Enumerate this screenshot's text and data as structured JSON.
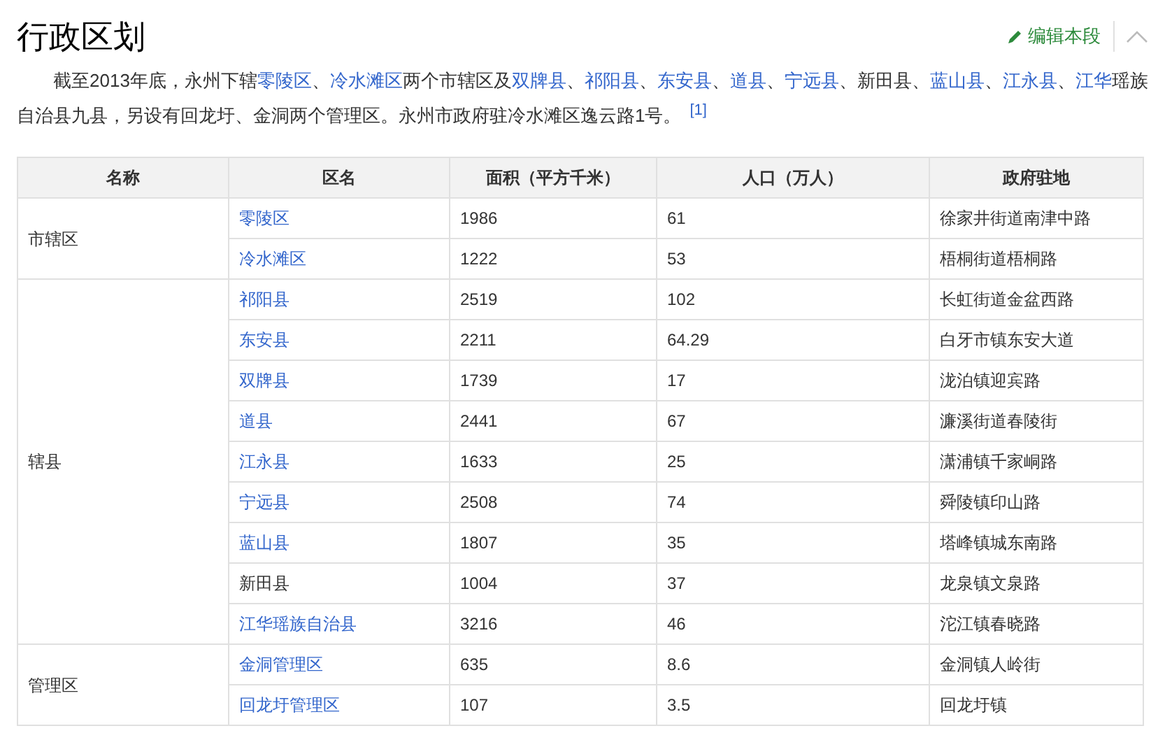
{
  "heading": "行政区划",
  "edit_link": "编辑本段",
  "paragraph": [
    {
      "text": "截至2013年底，永州下辖",
      "link": false
    },
    {
      "text": "零陵区",
      "link": true
    },
    {
      "text": "、",
      "link": false
    },
    {
      "text": "冷水滩区",
      "link": true
    },
    {
      "text": "两个市辖区及",
      "link": false
    },
    {
      "text": "双牌县",
      "link": true
    },
    {
      "text": "、",
      "link": false
    },
    {
      "text": "祁阳县",
      "link": true
    },
    {
      "text": "、",
      "link": false
    },
    {
      "text": "东安县",
      "link": true
    },
    {
      "text": "、",
      "link": false
    },
    {
      "text": "道县",
      "link": true
    },
    {
      "text": "、",
      "link": false
    },
    {
      "text": "宁远县",
      "link": true
    },
    {
      "text": "、新田县、",
      "link": false
    },
    {
      "text": "蓝山县",
      "link": true
    },
    {
      "text": "、",
      "link": false
    },
    {
      "text": "江永县",
      "link": true
    },
    {
      "text": "、",
      "link": false
    },
    {
      "text": "江华",
      "link": true
    },
    {
      "text": "瑶族自治县九县，另设有回龙圩、金洞两个管理区。永州市政府驻冷水滩区逸云路1号。",
      "link": false
    }
  ],
  "footnote": "[1]",
  "table": {
    "columns": [
      "名称",
      "区名",
      "面积（平方千米）",
      "人口（万人）",
      "政府驻地"
    ],
    "groups": [
      {
        "name": "市辖区",
        "rows": [
          {
            "district": "零陵区",
            "link": true,
            "area": "1986",
            "population": "61",
            "seat": "徐家井街道南津中路"
          },
          {
            "district": "冷水滩区",
            "link": true,
            "area": "1222",
            "population": "53",
            "seat": "梧桐街道梧桐路"
          }
        ]
      },
      {
        "name": "辖县",
        "rows": [
          {
            "district": "祁阳县",
            "link": true,
            "area": "2519",
            "population": "102",
            "seat": "长虹街道金盆西路"
          },
          {
            "district": "东安县",
            "link": true,
            "area": "2211",
            "population": "64.29",
            "seat": "白牙市镇东安大道"
          },
          {
            "district": "双牌县",
            "link": true,
            "area": "1739",
            "population": "17",
            "seat": "泷泊镇迎宾路"
          },
          {
            "district": "道县",
            "link": true,
            "area": "2441",
            "population": "67",
            "seat": "濂溪街道春陵街"
          },
          {
            "district": "江永县",
            "link": true,
            "area": "1633",
            "population": "25",
            "seat": "潇浦镇千家峒路"
          },
          {
            "district": "宁远县",
            "link": true,
            "area": "2508",
            "population": "74",
            "seat": "舜陵镇印山路"
          },
          {
            "district": "蓝山县",
            "link": true,
            "area": "1807",
            "population": "35",
            "seat": "塔峰镇城东南路"
          },
          {
            "district": "新田县",
            "link": false,
            "area": "1004",
            "population": "37",
            "seat": "龙泉镇文泉路"
          },
          {
            "district": "江华瑶族自治县",
            "link": true,
            "area": "3216",
            "population": "46",
            "seat": "沱江镇春晓路"
          }
        ]
      },
      {
        "name": "管理区",
        "rows": [
          {
            "district": "金洞管理区",
            "link": true,
            "area": "635",
            "population": "8.6",
            "seat": "金洞镇人岭街"
          },
          {
            "district": "回龙圩管理区",
            "link": true,
            "area": "107",
            "population": "3.5",
            "seat": "回龙圩镇"
          }
        ]
      }
    ]
  }
}
